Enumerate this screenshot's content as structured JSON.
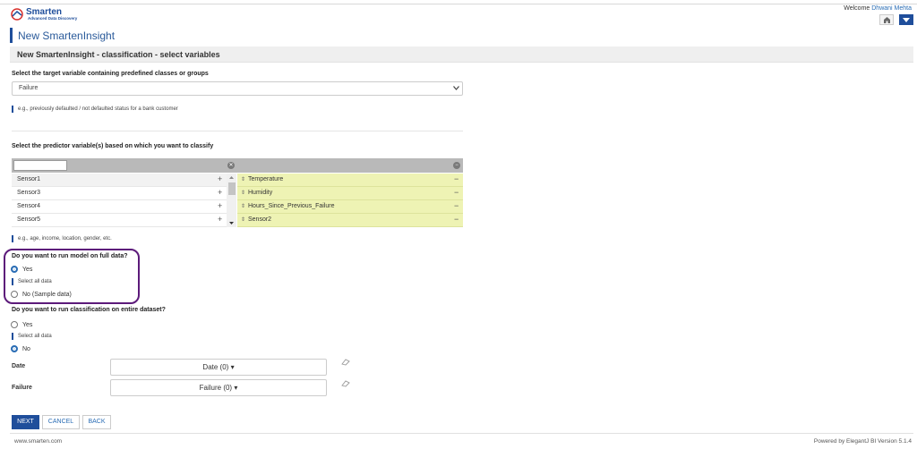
{
  "header": {
    "logo_text": "Smarten",
    "logo_sub": "Advanced Data Discovery",
    "welcome": "Welcome",
    "user": "Dhwani Mehta",
    "home_icon": "home-icon",
    "menu_icon": "caret-down-icon"
  },
  "page": {
    "title": "New SmartenInsight",
    "section_title": "New SmartenInsight - classification - select variables"
  },
  "target": {
    "label": "Select the target variable containing predefined classes or groups",
    "value": "Failure",
    "hint": "e.g., previously defaulted / not defaulted status for a bank customer"
  },
  "predictors": {
    "label": "Select the predictor variable(s) based on which you want to classify",
    "available": [
      "Sensor1",
      "Sensor3",
      "Sensor4",
      "Sensor5"
    ],
    "selected": [
      "Temperature",
      "Humidity",
      "Hours_Since_Previous_Failure",
      "Sensor2"
    ],
    "add_symbol": "+",
    "remove_symbol": "−",
    "grip_symbol": "⇕",
    "hint": "e.g., age, income, location, gender, etc."
  },
  "full_data": {
    "question": "Do you want to run model on full data?",
    "yes_label": "Yes",
    "yes_hint": "Select all data",
    "no_label": "No (Sample data)",
    "selected": "yes"
  },
  "entire_dataset": {
    "question": "Do you want to run classification on entire dataset?",
    "yes_label": "Yes",
    "yes_hint": "Select all data",
    "no_label": "No",
    "selected": "no"
  },
  "filters": [
    {
      "label": "Date",
      "dropdown": "Date (0)"
    },
    {
      "label": "Failure",
      "dropdown": "Failure (0)"
    }
  ],
  "buttons": {
    "next": "NEXT",
    "cancel": "CANCEL",
    "back": "BACK"
  },
  "footer": {
    "left": "www.smarten.com",
    "right": "Powered by ElegantJ BI Version 5.1.4"
  },
  "colors": {
    "brand": "#1f4e9b",
    "selected_list_bg": "#eef3b4",
    "highlight_annotation": "#5c1a7a"
  }
}
